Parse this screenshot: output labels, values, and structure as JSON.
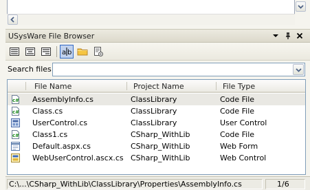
{
  "window": {
    "title": "USysWare File Browser"
  },
  "toolbar": {
    "buttons": [
      {
        "name": "view-option-1-icon",
        "active": false
      },
      {
        "name": "view-option-2-icon",
        "active": false
      },
      {
        "name": "view-option-3-icon",
        "active": false
      },
      {
        "name": "match-case-icon",
        "active": true
      },
      {
        "name": "folder-icon",
        "active": false
      },
      {
        "name": "properties-icon",
        "active": false
      }
    ]
  },
  "search": {
    "label": "Search files:",
    "value": "",
    "placeholder": ""
  },
  "columns": [
    "File Name",
    "Project Name",
    "File Type"
  ],
  "files": [
    {
      "icon": "csharp-file-icon",
      "name": "AssemblyInfo.cs",
      "project": "ClassLibrary",
      "type": "Code File",
      "selected": true
    },
    {
      "icon": "csharp-file-icon",
      "name": "Class.cs",
      "project": "ClassLibrary",
      "type": "Code File",
      "selected": false
    },
    {
      "icon": "user-control-icon",
      "name": "UserControl.cs",
      "project": "ClassLibrary",
      "type": "User Control",
      "selected": false
    },
    {
      "icon": "csharp-file-icon",
      "name": "Class1.cs",
      "project": "CSharp_WithLib",
      "type": "Code File",
      "selected": false
    },
    {
      "icon": "web-form-icon",
      "name": "Default.aspx.cs",
      "project": "CSharp_WithLib",
      "type": "Web Form",
      "selected": false
    },
    {
      "icon": "web-control-icon",
      "name": "WebUserControl.ascx.cs",
      "project": "CSharp_WithLib",
      "type": "Web Control",
      "selected": false
    }
  ],
  "status": {
    "path": "C:\\...\\CSharp_WithLib\\ClassLibrary\\Properties\\AssemblyInfo.cs",
    "count": "1/6"
  }
}
